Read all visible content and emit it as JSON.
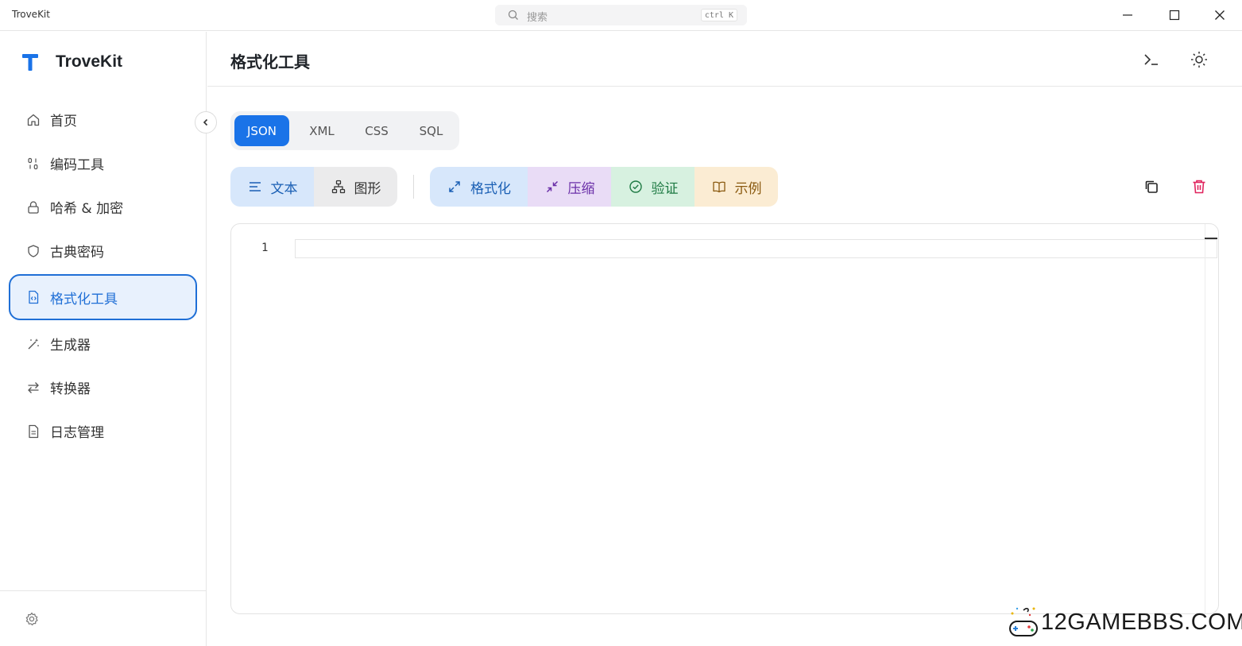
{
  "window": {
    "title": "TroveKit",
    "search_placeholder": "搜索",
    "search_shortcut": "ctrl K"
  },
  "sidebar": {
    "brand": "TroveKit",
    "items": [
      {
        "label": "首页",
        "icon": "home-icon"
      },
      {
        "label": "编码工具",
        "icon": "binary-icon"
      },
      {
        "label": "哈希 & 加密",
        "icon": "lock-icon"
      },
      {
        "label": "古典密码",
        "icon": "shield-icon"
      },
      {
        "label": "格式化工具",
        "icon": "file-code-icon",
        "active": true
      },
      {
        "label": "生成器",
        "icon": "magic-wand-icon"
      },
      {
        "label": "转换器",
        "icon": "swap-arrows-icon"
      },
      {
        "label": "日志管理",
        "icon": "document-icon"
      }
    ]
  },
  "header": {
    "title": "格式化工具"
  },
  "format_tabs": [
    "JSON",
    "XML",
    "CSS",
    "SQL"
  ],
  "active_format": "JSON",
  "view_modes": {
    "text": "文本",
    "graph": "图形"
  },
  "actions": {
    "format": "格式化",
    "compress": "压缩",
    "validate": "验证",
    "example": "示例"
  },
  "editor": {
    "line_number": "1"
  },
  "watermark": "12GAMEBBS.COM",
  "colors": {
    "accent": "#1a73e8",
    "format_bg": "#d7e7fb",
    "compress_bg": "#e9dcf6",
    "validate_bg": "#d7f1e0",
    "example_bg": "#fbecd3",
    "delete": "#e0245e"
  }
}
